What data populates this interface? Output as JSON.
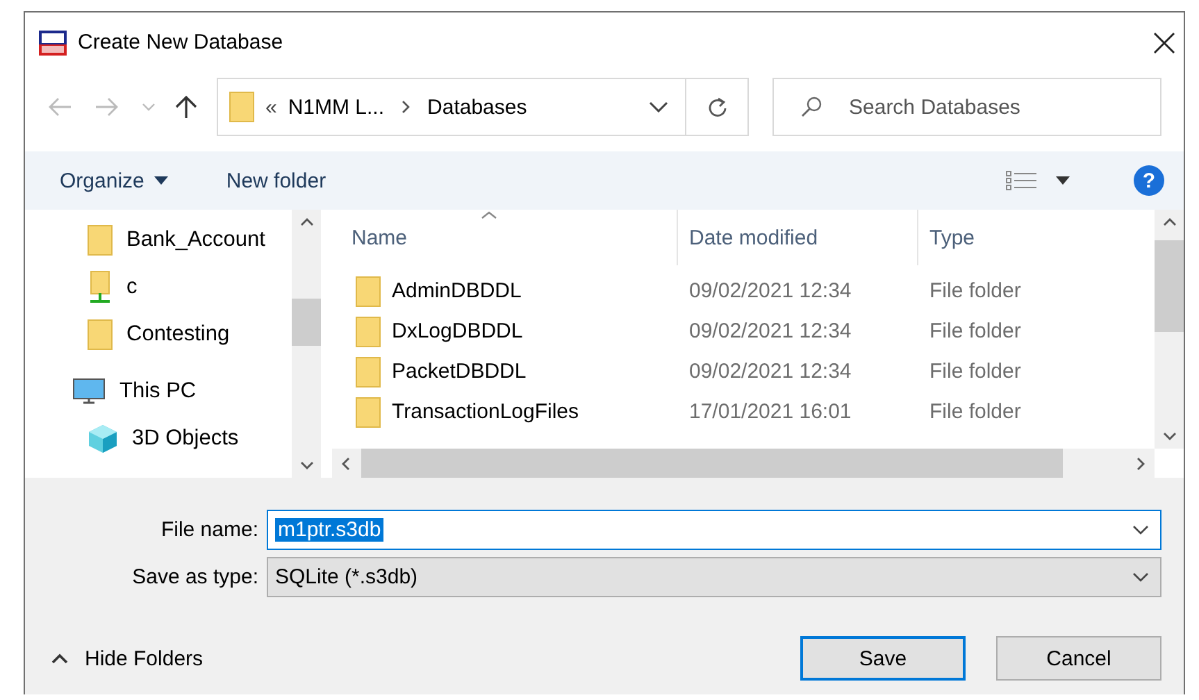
{
  "window": {
    "title": "Create New Database"
  },
  "address_bar": {
    "overflow": "«",
    "segments": [
      "N1MM L...",
      "Databases"
    ]
  },
  "search": {
    "placeholder": "Search Databases"
  },
  "toolbar": {
    "organize": "Organize",
    "new_folder": "New folder",
    "help": "?"
  },
  "nav_pane": {
    "items": [
      {
        "label": "Bank_Account",
        "kind": "folder"
      },
      {
        "label": "c",
        "kind": "network"
      },
      {
        "label": "Contesting",
        "kind": "folder"
      },
      {
        "label": "This PC",
        "kind": "pc"
      },
      {
        "label": "3D Objects",
        "kind": "objects"
      }
    ]
  },
  "file_list": {
    "columns": [
      "Name",
      "Date modified",
      "Type"
    ],
    "rows": [
      {
        "name": "AdminDBDDL",
        "date": "09/02/2021 12:34",
        "type": "File folder"
      },
      {
        "name": "DxLogDBDDL",
        "date": "09/02/2021 12:34",
        "type": "File folder"
      },
      {
        "name": "PacketDBDDL",
        "date": "09/02/2021 12:34",
        "type": "File folder"
      },
      {
        "name": "TransactionLogFiles",
        "date": "17/01/2021 16:01",
        "type": "File folder"
      }
    ]
  },
  "file_name": {
    "label": "File name:",
    "value": "m1ptr.s3db"
  },
  "save_as_type": {
    "label": "Save as type:",
    "value": "SQLite (*.s3db)"
  },
  "hide_folders": "Hide Folders",
  "buttons": [
    "Save",
    "Cancel"
  ]
}
